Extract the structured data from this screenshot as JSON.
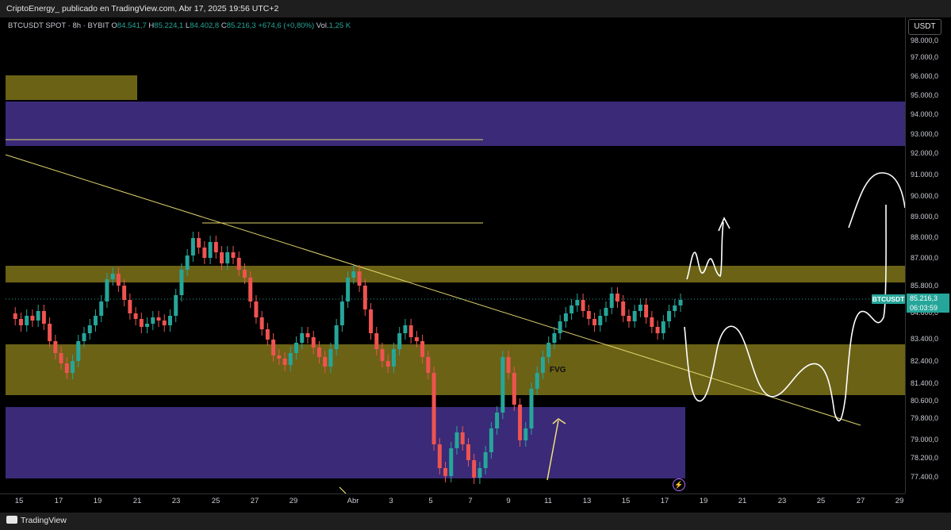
{
  "header": {
    "published": "CriptoEnergy_ publicado en TradingView.com, Abr 17, 2025 19:56 UTC+2"
  },
  "legend": {
    "symbol": "BTCUSDT SPOT · 8h · BYBIT",
    "o_label": "O",
    "o_value": "84.541,7",
    "h_label": "H",
    "h_value": "85.224,1",
    "l_label": "L",
    "l_value": "84.402,8",
    "c_label": "C",
    "c_value": "85.216,3",
    "change": "+674,6 (+0,80%)",
    "vol_label": "Vol.",
    "vol_value": "1,25 K"
  },
  "currency_button": "USDT",
  "price_axis": [
    "98.000,0",
    "97.000,0",
    "96.000,0",
    "95.000,0",
    "94.000,0",
    "93.000,0",
    "92.000,0",
    "91.000,0",
    "90.000,0",
    "89.000,0",
    "88.000,0",
    "87.000,0",
    "85.800,0",
    "84.600,0",
    "83.400,0",
    "82.400,0",
    "81.400,0",
    "80.600,0",
    "79.800,0",
    "79.000,0",
    "78.200,0",
    "77.400,0"
  ],
  "current_price": {
    "symbol": "BTCUSDT",
    "price": "85.216,3",
    "countdown": "06:03:59"
  },
  "time_axis": [
    "15",
    "17",
    "19",
    "21",
    "23",
    "25",
    "27",
    "29",
    "Abr",
    "3",
    "5",
    "7",
    "9",
    "11",
    "13",
    "15",
    "17",
    "19",
    "21",
    "23",
    "25",
    "27",
    "29"
  ],
  "annotation": {
    "fvg": "FVG"
  },
  "footer": {
    "brand": "TradingView"
  },
  "colors": {
    "up": "#26a69a",
    "down": "#ef5350",
    "zone_yellow": "#6b6216",
    "zone_purple": "#3a2a78",
    "trend": "#e0d26a"
  }
}
